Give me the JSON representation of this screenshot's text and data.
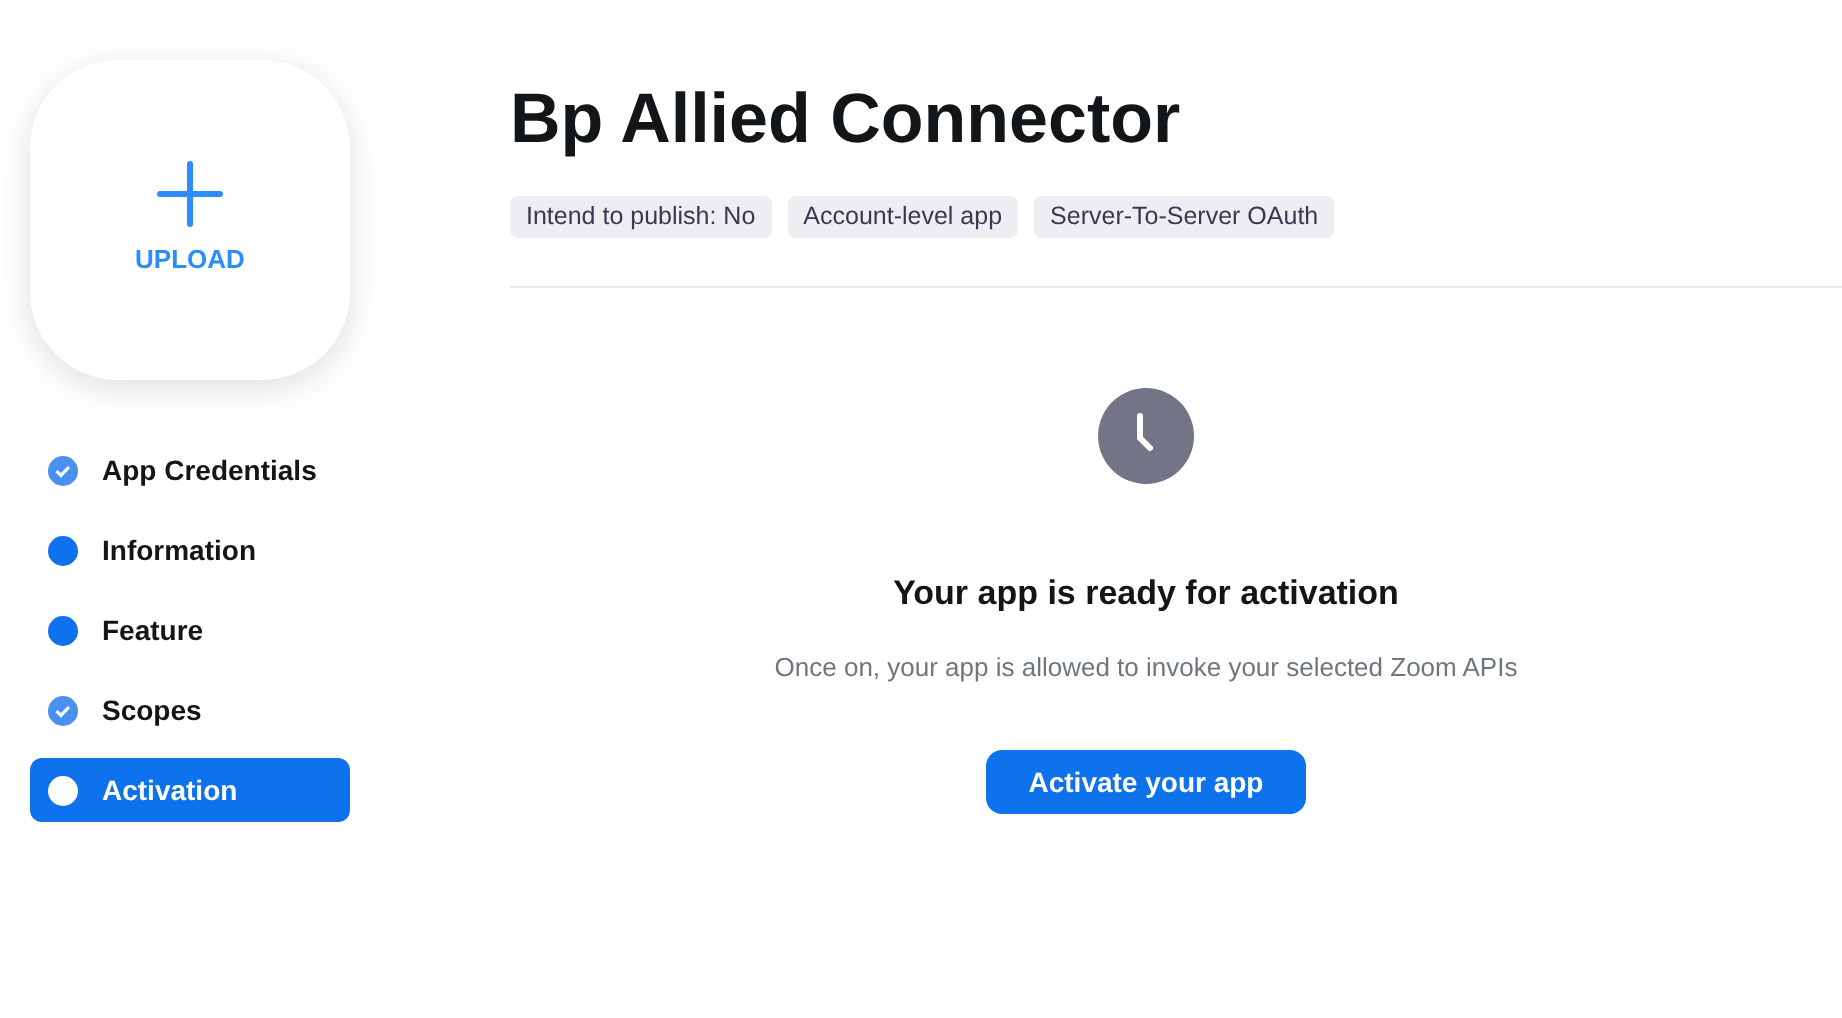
{
  "upload": {
    "label": "UPLOAD"
  },
  "steps": [
    {
      "label": "App Credentials",
      "completed": true,
      "selected": false
    },
    {
      "label": "Information",
      "completed": false,
      "selected": false
    },
    {
      "label": "Feature",
      "completed": false,
      "selected": false
    },
    {
      "label": "Scopes",
      "completed": true,
      "selected": false
    },
    {
      "label": "Activation",
      "completed": false,
      "selected": true
    }
  ],
  "title": "Bp Allied Connector",
  "tags": [
    "Intend to publish: No",
    "Account-level app",
    "Server-To-Server OAuth"
  ],
  "activation": {
    "heading": "Your app is ready for activation",
    "description": "Once on, your app is allowed to invoke your selected Zoom APIs",
    "button": "Activate your app"
  }
}
